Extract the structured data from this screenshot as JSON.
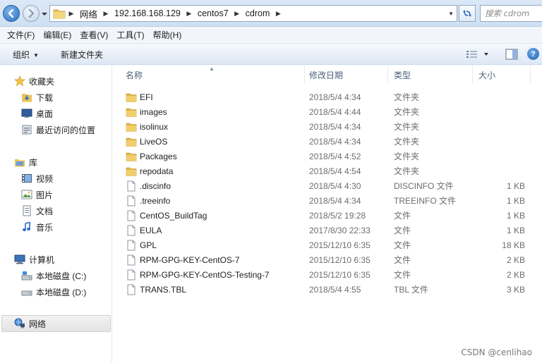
{
  "address": {
    "crumbs": [
      "网络",
      "192.168.168.129",
      "centos7",
      "cdrom"
    ],
    "search_placeholder": "搜索 cdrom"
  },
  "menu": [
    "文件(F)",
    "编辑(E)",
    "查看(V)",
    "工具(T)",
    "帮助(H)"
  ],
  "toolbar": {
    "organize": "组织",
    "new_folder": "新建文件夹"
  },
  "nav": {
    "favorites": "收藏夹",
    "downloads": "下载",
    "desktop": "桌面",
    "recent": "最近访问的位置",
    "libraries": "库",
    "videos": "视频",
    "pictures": "图片",
    "documents": "文档",
    "music": "音乐",
    "computer": "计算机",
    "drive_c": "本地磁盘 (C:)",
    "drive_d": "本地磁盘 (D:)",
    "network": "网络"
  },
  "columns": {
    "name": "名称",
    "date": "修改日期",
    "type": "类型",
    "size": "大小"
  },
  "files": [
    {
      "name": "EFI",
      "date": "2018/5/4 4:34",
      "type": "文件夹",
      "size": "",
      "kind": "folder"
    },
    {
      "name": "images",
      "date": "2018/5/4 4:44",
      "type": "文件夹",
      "size": "",
      "kind": "folder"
    },
    {
      "name": "isolinux",
      "date": "2018/5/4 4:34",
      "type": "文件夹",
      "size": "",
      "kind": "folder"
    },
    {
      "name": "LiveOS",
      "date": "2018/5/4 4:34",
      "type": "文件夹",
      "size": "",
      "kind": "folder"
    },
    {
      "name": "Packages",
      "date": "2018/5/4 4:52",
      "type": "文件夹",
      "size": "",
      "kind": "folder"
    },
    {
      "name": "repodata",
      "date": "2018/5/4 4:54",
      "type": "文件夹",
      "size": "",
      "kind": "folder"
    },
    {
      "name": ".discinfo",
      "date": "2018/5/4 4:30",
      "type": "DISCINFO 文件",
      "size": "1 KB",
      "kind": "file"
    },
    {
      "name": ".treeinfo",
      "date": "2018/5/4 4:34",
      "type": "TREEINFO 文件",
      "size": "1 KB",
      "kind": "file"
    },
    {
      "name": "CentOS_BuildTag",
      "date": "2018/5/2 19:28",
      "type": "文件",
      "size": "1 KB",
      "kind": "file"
    },
    {
      "name": "EULA",
      "date": "2017/8/30 22:33",
      "type": "文件",
      "size": "1 KB",
      "kind": "file"
    },
    {
      "name": "GPL",
      "date": "2015/12/10 6:35",
      "type": "文件",
      "size": "18 KB",
      "kind": "file"
    },
    {
      "name": "RPM-GPG-KEY-CentOS-7",
      "date": "2015/12/10 6:35",
      "type": "文件",
      "size": "2 KB",
      "kind": "file"
    },
    {
      "name": "RPM-GPG-KEY-CentOS-Testing-7",
      "date": "2015/12/10 6:35",
      "type": "文件",
      "size": "2 KB",
      "kind": "file"
    },
    {
      "name": "TRANS.TBL",
      "date": "2018/5/4 4:55",
      "type": "TBL 文件",
      "size": "3 KB",
      "kind": "file"
    }
  ],
  "watermark": "CSDN @cenlihao"
}
